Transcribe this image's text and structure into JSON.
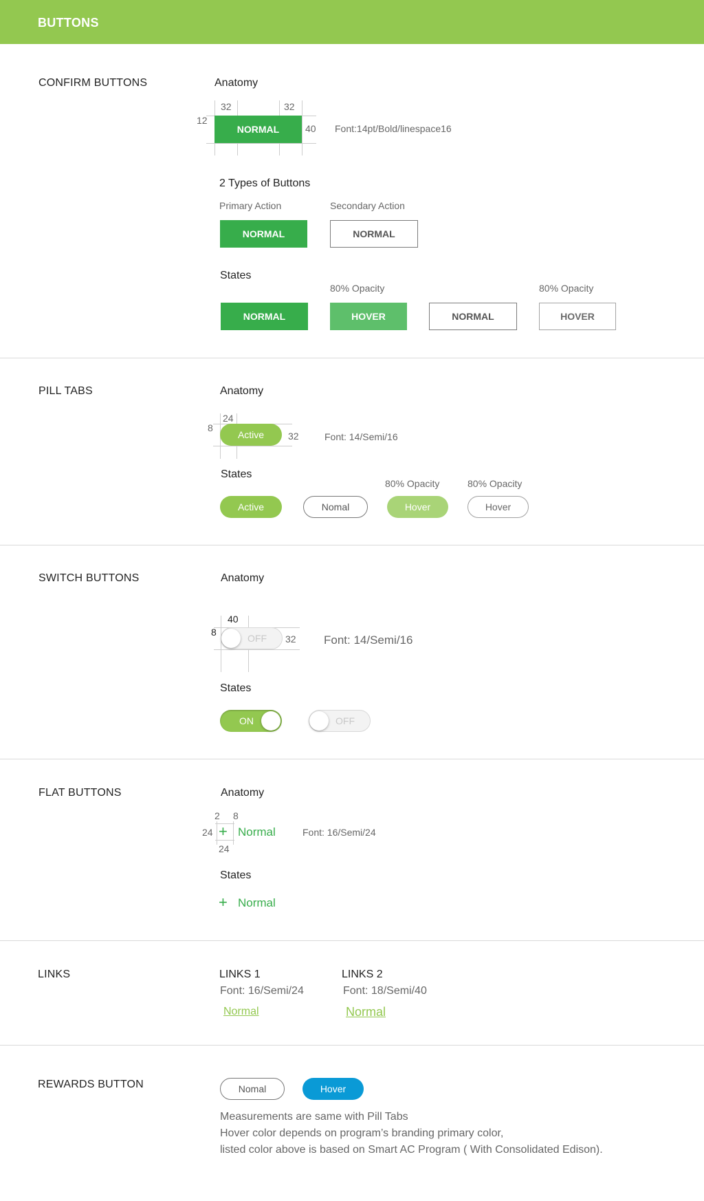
{
  "header": {
    "title": "BUTTONS"
  },
  "confirm": {
    "section": "CONFIRM BUTTONS",
    "anatomy_title": "Anatomy",
    "anatomy_button": "NORMAL",
    "dim_left": "32",
    "dim_right": "32",
    "dim_pad": "12",
    "dim_height": "40",
    "font_note": "Font:14pt/Bold/linespace16",
    "types_title": "2 Types of Buttons",
    "primary_label": "Primary Action",
    "secondary_label": "Secondary Action",
    "primary_button": "NORMAL",
    "secondary_button": "NORMAL",
    "states_title": "States",
    "opacity_1": "80% Opacity",
    "opacity_2": "80% Opacity",
    "state_normal": "NORMAL",
    "state_hover": "HOVER",
    "state_normal_2": "NORMAL",
    "state_hover_2": "HOVER"
  },
  "pill": {
    "section": "PILL TABS",
    "anatomy_title": "Anatomy",
    "anatomy_pill": "Active",
    "dim_width": "24",
    "dim_pad": "8",
    "dim_height": "32",
    "font_note": "Font: 14/Semi/16",
    "states_title": "States",
    "opacity_1": "80% Opacity",
    "opacity_2": "80% Opacity",
    "state_active": "Active",
    "state_normal": "Nomal",
    "state_hover": "Hover",
    "state_hover_outline": "Hover"
  },
  "switch": {
    "section": "SWITCH BUTTONS",
    "anatomy_title": "Anatomy",
    "anatomy_text": "OFF",
    "dim_width": "40",
    "dim_pad": "8",
    "dim_height": "32",
    "font_note": "Font: 14/Semi/16",
    "states_title": "States",
    "on_label": "ON",
    "off_label": "OFF"
  },
  "flat": {
    "section": "FLAT BUTTONS",
    "anatomy_title": "Anatomy",
    "dim_a": "2",
    "dim_b": "8",
    "dim_left": "24",
    "dim_bottom": "24",
    "anatomy_label": "Normal",
    "font_note": "Font: 16/Semi/24",
    "states_title": "States",
    "state_label": "Normal"
  },
  "links": {
    "section": "LINKS",
    "links1_title": "LINKS 1",
    "links1_font": "Font: 16/Semi/24",
    "links1_link": "Normal",
    "links2_title": "LINKS 2",
    "links2_font": "Font: 18/Semi/40",
    "links2_link": "Normal"
  },
  "rewards": {
    "section": "REWARDS BUTTON",
    "normal": "Nomal",
    "hover": "Hover",
    "note_1": "Measurements are same with Pill Tabs",
    "note_2": "Hover color depends on program’s branding primary color,",
    "note_3": "listed color above is based on Smart AC Program ( With Consolidated Edison)."
  },
  "colors": {
    "header_green": "#93c850",
    "primary_green": "#37ad4b",
    "reward_blue": "#0a9ad6"
  }
}
